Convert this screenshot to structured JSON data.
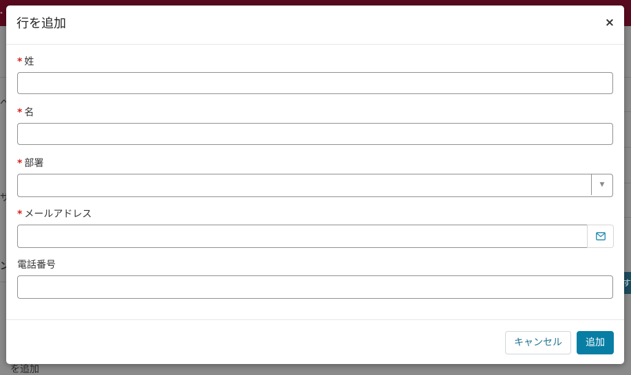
{
  "modal": {
    "title": "行を追加",
    "close_label": "×"
  },
  "form": {
    "fields": [
      {
        "label": "姓",
        "required": true,
        "required_mark": "*",
        "value": ""
      },
      {
        "label": "名",
        "required": true,
        "required_mark": "*",
        "value": ""
      },
      {
        "label": "部署",
        "required": true,
        "required_mark": "*",
        "value": "",
        "select_arrow": "▼"
      },
      {
        "label": "メールアドレス",
        "required": true,
        "required_mark": "*",
        "value": "",
        "icon": "mail-icon"
      },
      {
        "label": "電話番号",
        "required": false,
        "value": ""
      }
    ]
  },
  "footer": {
    "cancel_label": "キャンセル",
    "add_label": "追加"
  },
  "background": {
    "fragments": [
      "ペ",
      "ザ",
      "ン",
      "す",
      "を追加"
    ]
  },
  "colors": {
    "topbar": "#5a0a1e",
    "primary_button": "#087ea4",
    "required_mark": "#d62222",
    "mail_icon": "#2a8fb3"
  }
}
